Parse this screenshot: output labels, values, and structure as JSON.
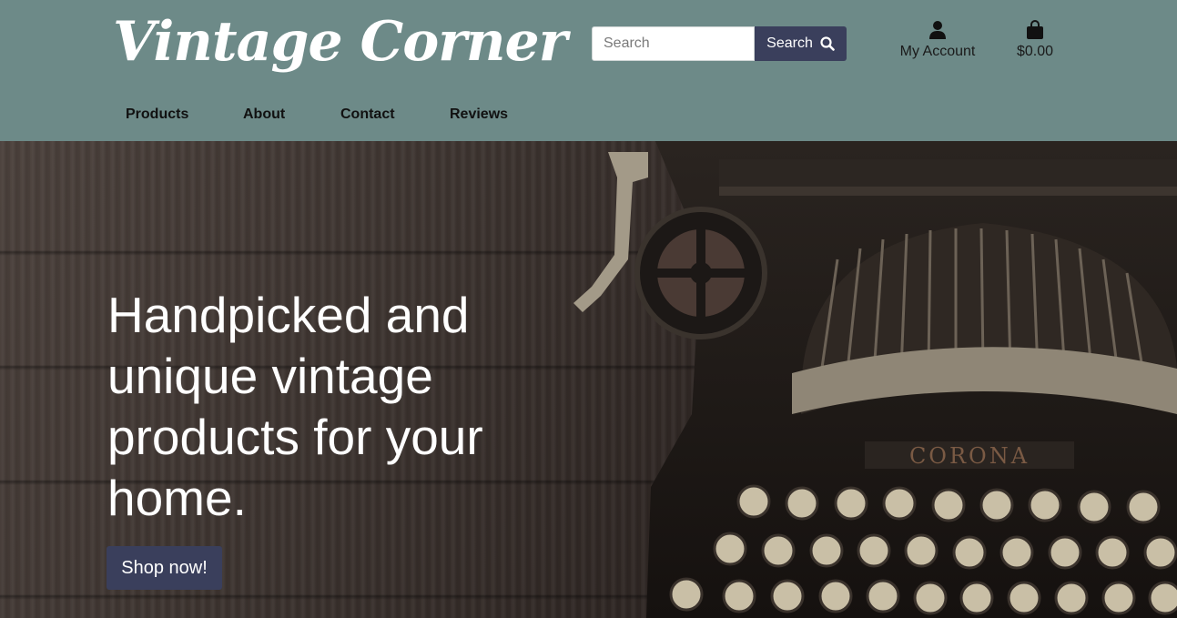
{
  "header": {
    "logo_text": "Vintage Corner",
    "search": {
      "placeholder": "Search",
      "button_label": "Search",
      "icon": "search-icon"
    },
    "account": {
      "label": "My Account",
      "icon": "user-icon"
    },
    "cart": {
      "total": "$0.00",
      "icon": "shopping-bag-icon"
    },
    "nav": [
      {
        "label": "Products"
      },
      {
        "label": "About"
      },
      {
        "label": "Contact"
      },
      {
        "label": "Reviews"
      }
    ]
  },
  "hero": {
    "title": "Handpicked and unique vintage products for your home.",
    "cta_label": "Shop now!",
    "image_subject": "vintage-typewriter"
  },
  "colors": {
    "header_bg": "#6d8a88",
    "button_bg": "#3a3f5c",
    "text_light": "#ffffff"
  }
}
